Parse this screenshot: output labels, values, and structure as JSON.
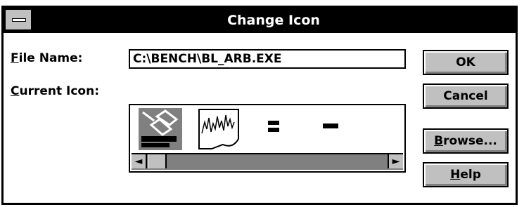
{
  "window": {
    "title": "Change Icon"
  },
  "labels": {
    "file_name_mnemonic": "F",
    "file_name_rest": "ile Name:",
    "current_icon_mnemonic": "C",
    "current_icon_rest": "urrent Icon:"
  },
  "file_name_field": {
    "value": "C:\\BENCH\\BL_ARB.EXE"
  },
  "icons": [
    "bench-link-icon",
    "waveform-icon",
    "double-bar-icon",
    "single-bar-icon"
  ],
  "buttons": {
    "ok": "OK",
    "cancel": "Cancel",
    "browse_mnemonic": "B",
    "browse_rest": "rowse...",
    "help_mnemonic": "H",
    "help_rest": "elp"
  },
  "scrollbar": {
    "left_arrow": "◄",
    "right_arrow": "►"
  }
}
